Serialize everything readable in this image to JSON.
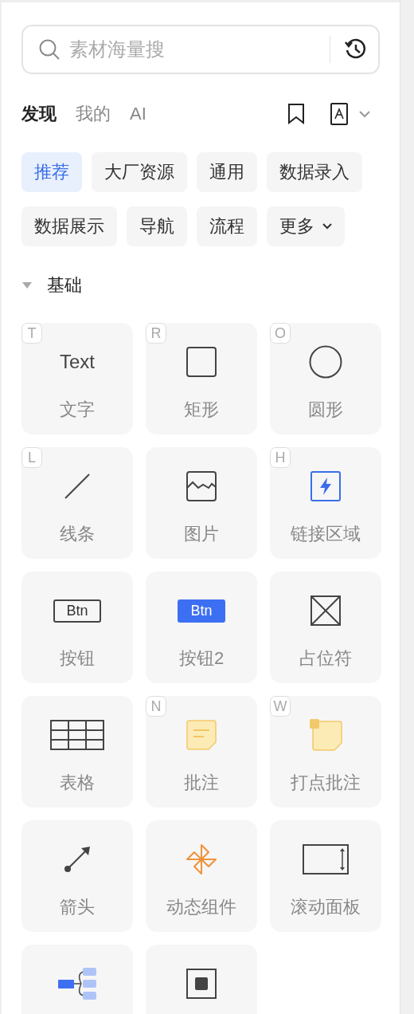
{
  "search": {
    "placeholder": "素材海量搜"
  },
  "tabs": [
    {
      "label": "发现",
      "selected": true
    },
    {
      "label": "我的",
      "selected": false
    },
    {
      "label": "AI",
      "selected": false
    }
  ],
  "chips": [
    {
      "label": "推荐",
      "selected": true,
      "kind": "plain"
    },
    {
      "label": "大厂资源",
      "selected": false,
      "kind": "plain"
    },
    {
      "label": "通用",
      "selected": false,
      "kind": "plain"
    },
    {
      "label": "数据录入",
      "selected": false,
      "kind": "plain"
    },
    {
      "label": "数据展示",
      "selected": false,
      "kind": "plain"
    },
    {
      "label": "导航",
      "selected": false,
      "kind": "plain"
    },
    {
      "label": "流程",
      "selected": false,
      "kind": "plain"
    },
    {
      "label": "更多",
      "selected": false,
      "kind": "dropdown"
    }
  ],
  "section": {
    "title": "基础",
    "expanded": true
  },
  "components": [
    {
      "kind": "text",
      "preview": "Text",
      "label": "文字",
      "shortcut": "T"
    },
    {
      "kind": "rectangle",
      "label": "矩形",
      "shortcut": "R"
    },
    {
      "kind": "circle",
      "label": "圆形",
      "shortcut": "O"
    },
    {
      "kind": "line",
      "label": "线条",
      "shortcut": "L"
    },
    {
      "kind": "image",
      "label": "图片"
    },
    {
      "kind": "link",
      "label": "链接区域",
      "shortcut": "H"
    },
    {
      "kind": "button",
      "preview": "Btn",
      "label": "按钮"
    },
    {
      "kind": "button_filled",
      "preview": "Btn",
      "label": "按钮2"
    },
    {
      "kind": "placeholder",
      "label": "占位符"
    },
    {
      "kind": "table",
      "label": "表格"
    },
    {
      "kind": "note",
      "label": "批注",
      "shortcut": "N"
    },
    {
      "kind": "dot_note",
      "label": "打点批注",
      "shortcut": "W"
    },
    {
      "kind": "arrow",
      "label": "箭头"
    },
    {
      "kind": "dynamic",
      "label": "动态组件"
    },
    {
      "kind": "scroll_panel",
      "label": "滚动面板"
    },
    {
      "kind": "mind_map"
    },
    {
      "kind": "frame"
    }
  ]
}
